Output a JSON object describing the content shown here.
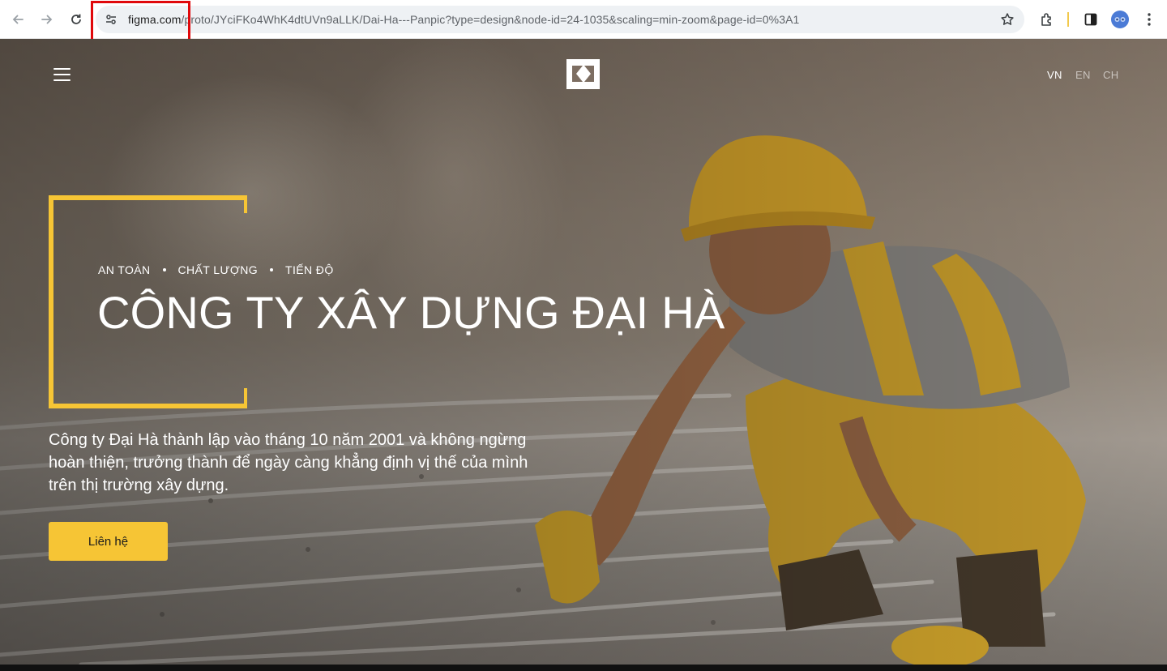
{
  "browser": {
    "url_host": "figma.com",
    "url_path": "/proto/JYciFKo4WhK4dtUVn9aLLK/Dai-Ha---Panpic?type=design&node-id=24-1035&scaling=min-zoom&page-id=0%3A1",
    "icons": [
      "back-arrow-icon",
      "forward-arrow-icon",
      "reload-icon",
      "site-settings-icon",
      "star-icon",
      "extensions-icon",
      "side-panel-icon",
      "profile-avatar",
      "more-vert-icon"
    ],
    "colors": {
      "highlight": "#e0080b",
      "omnibox_bg": "#eef1f4"
    }
  },
  "site": {
    "languages": [
      {
        "code": "VN",
        "active": true
      },
      {
        "code": "EN",
        "active": false
      },
      {
        "code": "CH",
        "active": false
      }
    ],
    "tagline": [
      "AN TOÀN",
      "CHẤT LƯỢNG",
      "TIẾN ĐỘ"
    ],
    "headline": "CÔNG TY XÂY DỰNG ĐẠI HÀ",
    "description": "Công ty Đại Hà thành lập vào tháng 10 năm 2001 và không ngừng hoàn thiện, trưởng thành để ngày càng khẳng định vị thế của mình trên thị trường xây dựng.",
    "cta_label": "Liên hệ",
    "colors": {
      "accent": "#f6c535",
      "text": "#ffffff"
    }
  }
}
